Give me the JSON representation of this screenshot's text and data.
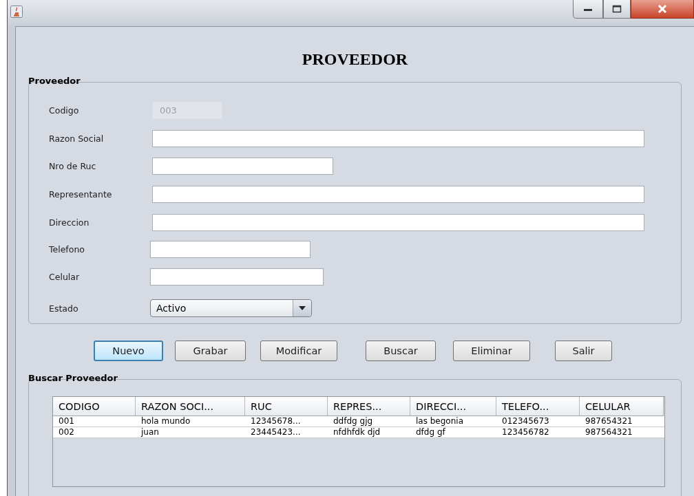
{
  "window": {
    "title": "PROVEEDOR"
  },
  "form": {
    "legend": "Proveedor",
    "fields": [
      {
        "label": "Codigo",
        "kind": "text",
        "value": "003",
        "disabled": true
      },
      {
        "label": "Razon Social",
        "kind": "text",
        "disabled": false
      },
      {
        "label": "Nro de Ruc",
        "kind": "text",
        "disabled": false
      },
      {
        "label": "Representante",
        "kind": "text",
        "disabled": false
      },
      {
        "label": "Direccion",
        "kind": "text",
        "disabled": false
      },
      {
        "label": "Telefono",
        "kind": "text",
        "disabled": false
      },
      {
        "label": "Celular",
        "kind": "text",
        "disabled": false
      },
      {
        "label": "Estado",
        "kind": "combo",
        "value": "Activo"
      }
    ]
  },
  "buttons": [
    {
      "label": "Nuevo",
      "focused": true
    },
    {
      "label": "Grabar",
      "focused": false
    },
    {
      "label": "Modificar",
      "focused": false
    },
    {
      "label": "Buscar",
      "focused": false
    },
    {
      "label": "Eliminar",
      "focused": false
    },
    {
      "label": "Salir",
      "focused": false
    }
  ],
  "search": {
    "legend": "Buscar Proveedor",
    "table": {
      "columns": [
        "CODIGO",
        "RAZON SOCI...",
        "RUC",
        "REPRES...",
        "DIRECCI...",
        "TELEFO...",
        "CELULAR"
      ],
      "rows": [
        [
          "001",
          "hola mundo",
          "12345678...",
          "ddfdg gjg",
          "las begonia",
          "012345673",
          "987654321"
        ],
        [
          "002",
          "juan",
          "23445423...",
          "nfdhfdk djd",
          "dfdg gf",
          "123456782",
          "987564321"
        ]
      ]
    }
  }
}
